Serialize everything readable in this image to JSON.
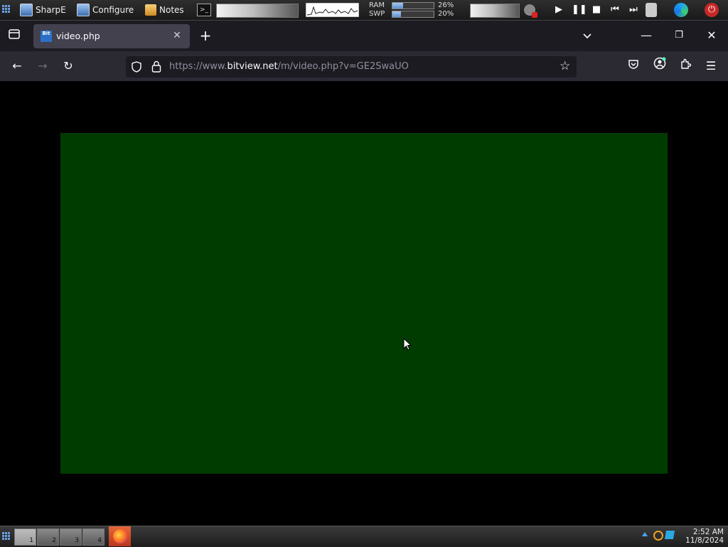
{
  "system_panel": {
    "launchers": [
      {
        "label": "SharpE",
        "icon": "monitor-icon"
      },
      {
        "label": "Configure",
        "icon": "monitor-icon"
      },
      {
        "label": "Notes",
        "icon": "notes-icon"
      }
    ],
    "terminal_icon_text": ">_",
    "memory": {
      "ram_label": "RAM",
      "ram_value": "26%",
      "ram_fraction": 0.26,
      "swp_label": "SWP",
      "swp_value": "20%",
      "swp_fraction": 0.2
    },
    "media_controls": [
      "play",
      "pause",
      "stop",
      "previous",
      "next"
    ]
  },
  "browser": {
    "tab": {
      "title": "video.php",
      "favicon_text": "Bit"
    },
    "url": {
      "prefix": "https://www.",
      "host": "bitview.net",
      "path": "/m/video.php?v=GE2SwaUO"
    },
    "video_background": "#003c00",
    "toolbar_bg": "#2b2a33",
    "tabbar_bg": "#1c1b22"
  },
  "taskbar": {
    "workspaces": [
      "1",
      "2",
      "3",
      "4"
    ],
    "active_workspace": "1",
    "clock": {
      "time": "2:52 AM",
      "date": "11/8/2024"
    }
  }
}
